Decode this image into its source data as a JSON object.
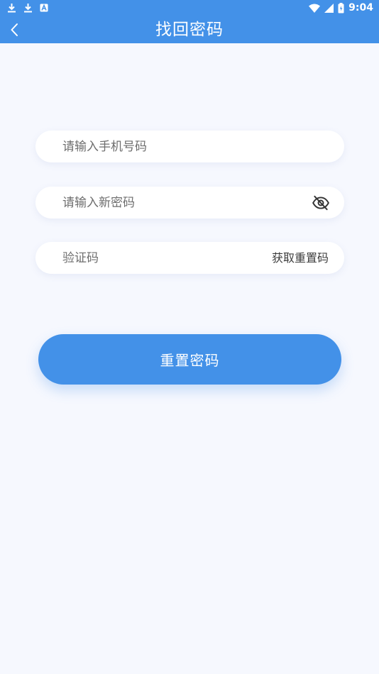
{
  "status_bar": {
    "time": "9:04",
    "left_icons": [
      "download-icon",
      "download-icon",
      "a-badge-icon"
    ],
    "right_icons": [
      "wifi-icon",
      "signal-icon",
      "battery-icon"
    ]
  },
  "header": {
    "title": "找回密码",
    "back_icon": "chevron-left-icon",
    "background_color": "#4391e8"
  },
  "form": {
    "phone_placeholder": "请输入手机号码",
    "password_placeholder": "请输入新密码",
    "password_toggle_icon": "eye-off-icon",
    "code_placeholder": "验证码",
    "get_code_label": "获取重置码",
    "submit_label": "重置密码"
  },
  "colors": {
    "accent": "#4391e8",
    "background": "#f6f8fe",
    "field_background": "#ffffff"
  }
}
